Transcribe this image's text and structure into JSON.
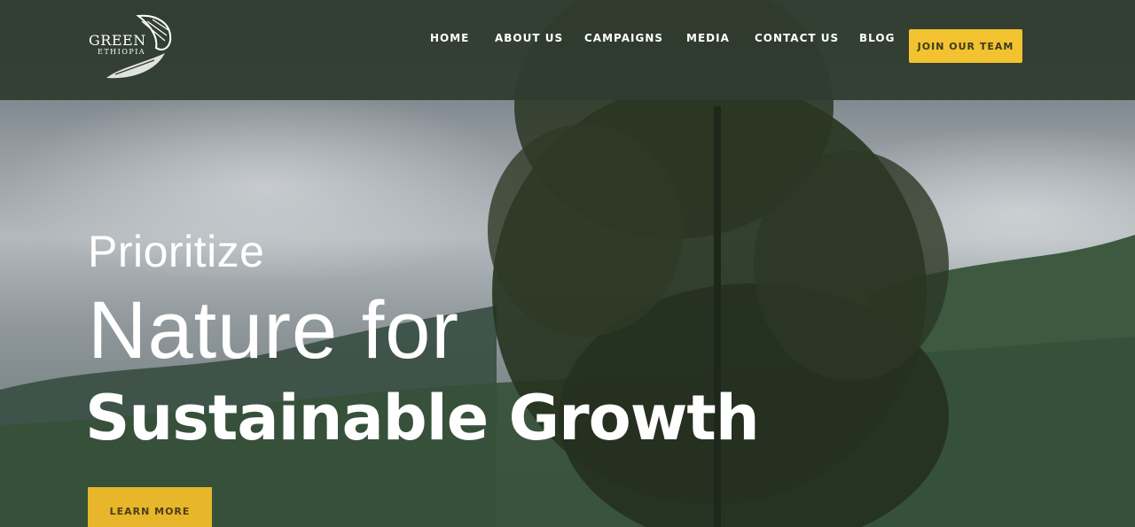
{
  "brand": {
    "name": "GREEN",
    "sub": "ETHIOPIA"
  },
  "nav": {
    "items": [
      {
        "label": "HOME"
      },
      {
        "label": "ABOUT US"
      },
      {
        "label": "CAMPAIGNS"
      },
      {
        "label": "MEDIA"
      },
      {
        "label": "CONTACT US"
      },
      {
        "label": "BLOG"
      }
    ],
    "cta_label": "JOIN OUR TEAM"
  },
  "hero": {
    "line1": "Prioritize",
    "line2": "Nature for",
    "line3": "Sustainable Growth",
    "button_label": "LEARN MORE"
  },
  "colors": {
    "nav_bg": "#303c2f",
    "accent": "#f2c230",
    "text": "#ffffff"
  },
  "icons": {
    "logo": "leaf-bird-logo-icon"
  }
}
